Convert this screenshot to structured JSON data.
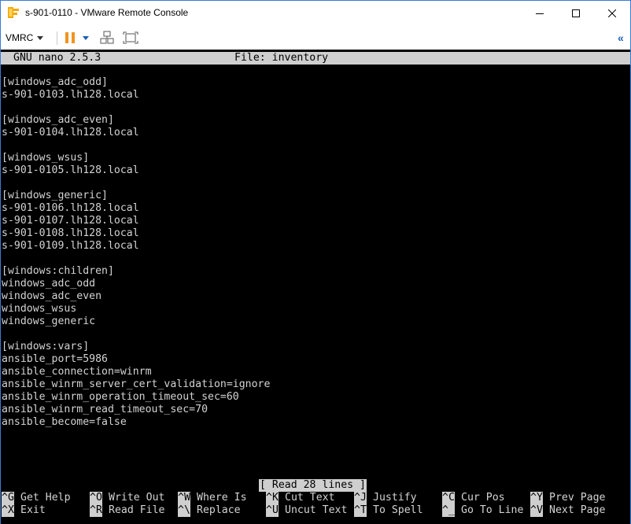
{
  "window": {
    "title": "s-901-0110 - VMware Remote Console"
  },
  "toolbar": {
    "vmrc_label": "VMRC",
    "collapse_glyph": "«"
  },
  "nano": {
    "version": "GNU nano 2.5.3",
    "file": "File: inventory",
    "status": "[ Read 28 lines ]",
    "lines": [
      "[windows_adc_odd]",
      "s-901-0103.lh128.local",
      "",
      "[windows_adc_even]",
      "s-901-0104.lh128.local",
      "",
      "[windows_wsus]",
      "s-901-0105.lh128.local",
      "",
      "[windows_generic]",
      "s-901-0106.lh128.local",
      "s-901-0107.lh128.local",
      "s-901-0108.lh128.local",
      "s-901-0109.lh128.local",
      "",
      "[windows:children]",
      "windows_adc_odd",
      "windows_adc_even",
      "windows_wsus",
      "windows_generic",
      "",
      "[windows:vars]",
      "ansible_port=5986",
      "ansible_connection=winrm",
      "ansible_winrm_server_cert_validation=ignore",
      "ansible_winrm_operation_timeout_sec=60",
      "ansible_winrm_read_timeout_sec=70",
      "ansible_become=false"
    ],
    "shortcuts_top": [
      {
        "key": "^G",
        "label": "Get Help"
      },
      {
        "key": "^O",
        "label": "Write Out"
      },
      {
        "key": "^W",
        "label": "Where Is"
      },
      {
        "key": "^K",
        "label": "Cut Text"
      },
      {
        "key": "^J",
        "label": "Justify"
      },
      {
        "key": "^C",
        "label": "Cur Pos"
      },
      {
        "key": "^Y",
        "label": "Prev Page"
      }
    ],
    "shortcuts_bottom": [
      {
        "key": "^X",
        "label": "Exit"
      },
      {
        "key": "^R",
        "label": "Read File"
      },
      {
        "key": "^\\",
        "label": "Replace"
      },
      {
        "key": "^U",
        "label": "Uncut Text"
      },
      {
        "key": "^T",
        "label": "To Spell"
      },
      {
        "key": "^_",
        "label": "Go To Line"
      },
      {
        "key": "^V",
        "label": "Next Page"
      }
    ]
  }
}
